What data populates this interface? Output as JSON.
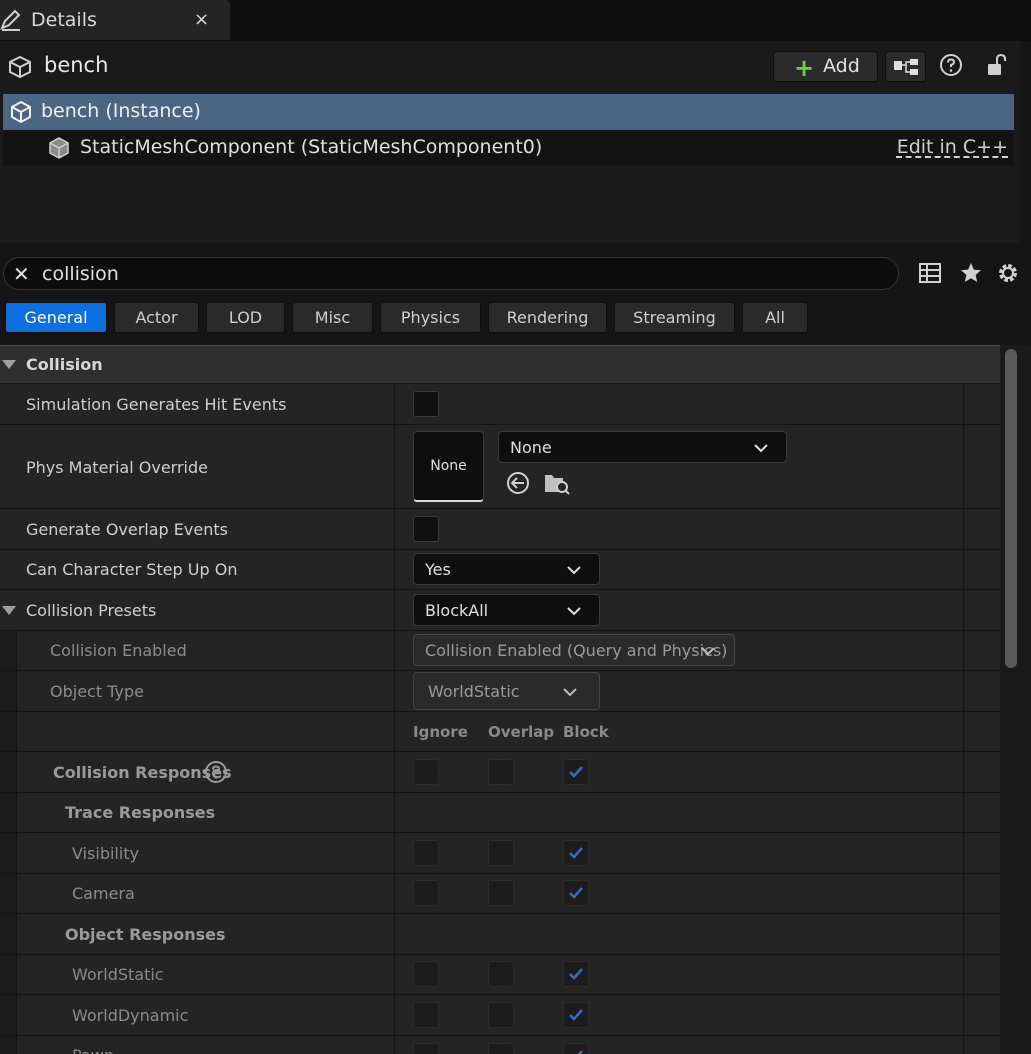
{
  "tab": {
    "title": "Details",
    "close_label": "×"
  },
  "header": {
    "actor_name": "bench",
    "add_label": "Add",
    "instance_label": "bench (Instance)",
    "component_label": "StaticMeshComponent (StaticMeshComponent0)",
    "edit_label": "Edit in C++"
  },
  "search": {
    "value": "collision"
  },
  "filters": [
    "General",
    "Actor",
    "LOD",
    "Misc",
    "Physics",
    "Rendering",
    "Streaming",
    "All"
  ],
  "collision": {
    "category": "Collision",
    "sim_hit_events": "Simulation Generates Hit Events",
    "phys_material": "Phys Material Override",
    "phys_thumb": "None",
    "phys_combo": "None",
    "overlap_events": "Generate Overlap Events",
    "step_up": "Can Character Step Up On",
    "step_up_value": "Yes",
    "presets": "Collision Presets",
    "presets_value": "BlockAll",
    "enabled": "Collision Enabled",
    "enabled_value": "Collision Enabled (Query and Physics)",
    "object_type": "Object Type",
    "object_type_value": "WorldStatic",
    "col_ignore": "Ignore",
    "col_overlap": "Overlap",
    "col_block": "Block",
    "responses": "Collision Responses",
    "trace_responses": "Trace Responses",
    "visibility": "Visibility",
    "camera": "Camera",
    "object_responses": "Object Responses",
    "world_static": "WorldStatic",
    "world_dynamic": "WorldDynamic",
    "pawn": "Pawn"
  },
  "colors": {
    "accent": "#0e6fe0",
    "selection": "#4b6584",
    "add_plus": "#6fcf3c"
  }
}
